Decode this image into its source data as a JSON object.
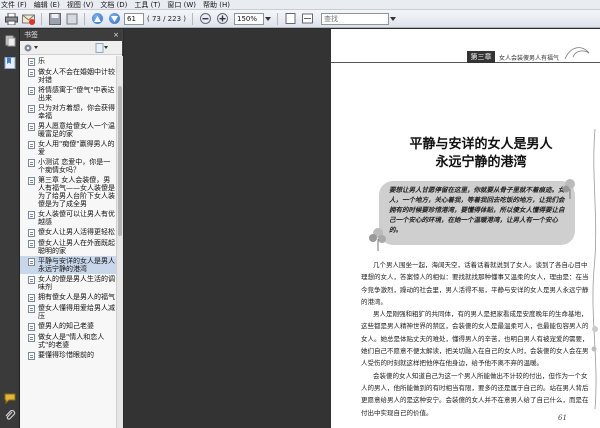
{
  "menu": [
    "文件 (F)",
    "编辑 (E)",
    "视图 (V)",
    "文档 (D)",
    "工具 (T)",
    "窗口 (W)",
    "帮助 (H)"
  ],
  "toolbar": {
    "page_value": "61",
    "page_total": "( 73 / 223 )",
    "zoom_value": "150%",
    "search_placeholder": "查找"
  },
  "bookmarks": {
    "header": "书签",
    "close": "×",
    "items": [
      "乐",
      "做女人不会在婚姻中计较对错",
      "将情感寓于\"傻气\"中表达出来",
      "只为对方着想，你会获得幸福",
      "男人愿意给傻女人一个温暖富足的家",
      "女人用\"痴傻\"赢得男人的爱",
      "小测试 恋爱中，你是一个痴情女吗？",
      "第三章 女人会装傻，男人有福气——女人装傻是为了给男人台阶下女人装傻是为了成全男",
      "女人装傻可以让男人有优越感",
      "傻女人让男人活得更轻松",
      "傻女人让男人在外面既起聪明的家",
      "平静与安详的女人是男人永远宁静的港湾",
      "女人的傻是男人生活的调味剂",
      "拥有傻女人是男人的福气",
      "傻女人懂得用爱给男人减压",
      "傻男人的知己老婆",
      "做女人是\"情人和恋人式\"的老婆",
      "要懂得珍惜眼前的"
    ],
    "selected_index": 11
  },
  "page": {
    "chapter_label": "第三章",
    "chapter_sub": "女人会装傻男人有福气",
    "title_line1": "平静与安详的女人是男人",
    "title_line2": "永远宁静的港湾",
    "quote": "要想让男人甘愿停留在这里，你就要从骨子里就不着痕迹。女人，一个地方，关心着我，等着我回去吃饭的地方，让我们会拥有的时候要珍惜港湾，要懂得体贴，所以傻女人懂得要让自己一个安心的环境，在她一个温暖港湾，让男人有一个安心的。",
    "paragraphs": [
      "几个男人围坐一起，海阔天空，话着话着就说到了女人。谈到了各自心目中理想的女人，答案惊人的相似：要找就找那种懂事又温柔的女人，理由是：在当今竞争激烈，躁动的社会里，男人活得不易，平静与安详的女人是男人永远宁静的港湾。",
      "男人是刚强和粗犷的共同体，有的男人是把家看成是安度晚年的生命基地，这些都是男人精神世界的禁区，会装傻的女人是最温柔可人，也最能包容男人的女人。她总是体贴丈夫的难处，懂得男人的辛苦，也明白男人有被宠爱的需要，她们自己不愿意不便太解读，把关切融入在自己的女人时，会装傻的女人会在男人受伤的时刻就这样把他停在他身边，给予他不离不弃的温暖。",
      "会装傻的女人知道自己为这一个男人所能做出不计较的付出，但作为一个女人的男人，他所能做到的有时相当有限，要多的还是属于自己的。站在男人背后更愿意给男人的是这种安宁。会装傻的女人并不在意男人给了自己什么，而是在付出中实现自己的价值。"
    ],
    "page_number": "61"
  }
}
